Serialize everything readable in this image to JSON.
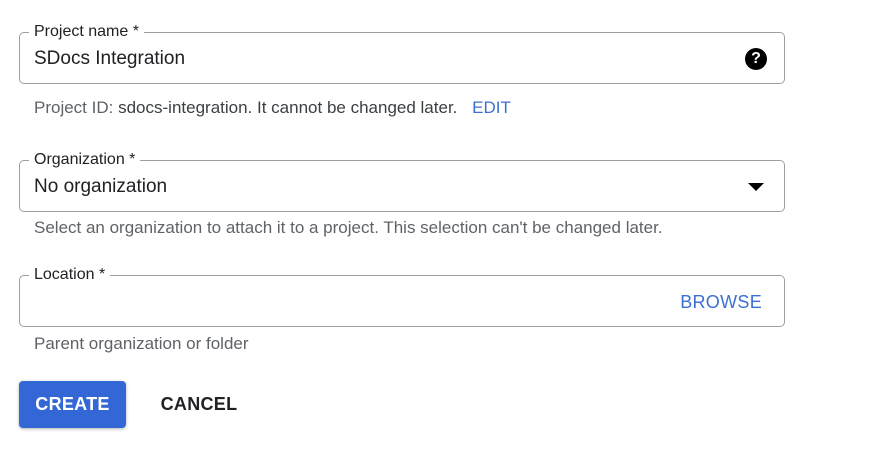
{
  "project_name": {
    "label": "Project name *",
    "value": "SDocs Integration",
    "help_icon": "help-circle-icon"
  },
  "project_id": {
    "prefix": "Project ID:",
    "id": "sdocs-integration.",
    "suffix": "It cannot be changed later.",
    "edit_label": "EDIT"
  },
  "organization": {
    "label": "Organization *",
    "value": "No organization",
    "dropdown_icon": "arrow-drop-down-icon",
    "hint": "Select an organization to attach it to a project. This selection can't be changed later."
  },
  "location": {
    "label": "Location *",
    "value": "",
    "browse_label": "BROWSE",
    "hint": "Parent organization or folder"
  },
  "actions": {
    "create_label": "CREATE",
    "cancel_label": "CANCEL"
  },
  "colors": {
    "accent": "#3367d6",
    "link": "#3c6fd1",
    "border": "#9aa0a6",
    "hint_text": "#5f6368"
  }
}
